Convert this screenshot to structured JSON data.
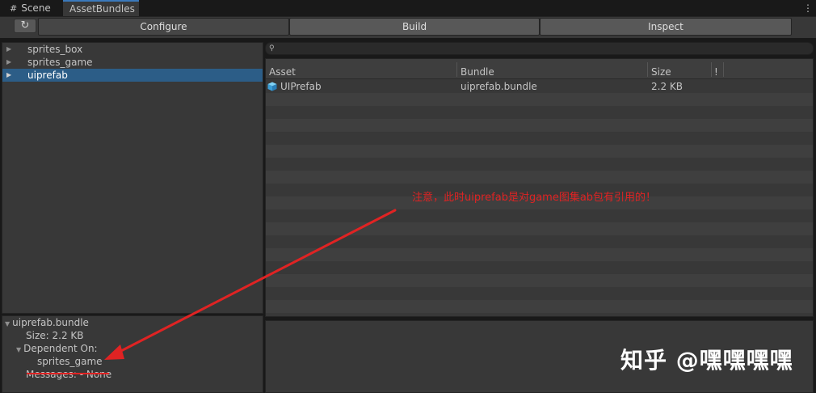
{
  "tabs": [
    {
      "icon": "grid-icon",
      "label": "Scene"
    },
    {
      "label": "AssetBundles"
    }
  ],
  "menu_glyph": "⋮",
  "toolbar": {
    "refresh_glyph": "↻",
    "modes": [
      "Configure",
      "Build",
      "Inspect"
    ],
    "selected_mode": "Configure"
  },
  "tree": {
    "items": [
      {
        "label": "sprites_box",
        "selected": false
      },
      {
        "label": "sprites_game",
        "selected": false
      },
      {
        "label": "uiprefab",
        "selected": true
      }
    ]
  },
  "details": {
    "bundle": "uiprefab.bundle",
    "size": "Size: 2.2 KB",
    "dependent_label": "Dependent On:",
    "dependency": "sprites_game",
    "messages": "Messages: - None"
  },
  "search": {
    "placeholder": ""
  },
  "table": {
    "columns": [
      "Asset",
      "Bundle",
      "Size",
      "!"
    ],
    "rows": [
      {
        "asset": "UIPrefab",
        "bundle": "uiprefab.bundle",
        "size": "2.2 KB"
      }
    ]
  },
  "annotation": {
    "text": "注意，此时uiprefab是对game图集ab包有引用的！",
    "color": "#e02323"
  },
  "watermark": "知乎 @嘿嘿嘿嘿",
  "colors": {
    "selection": "#2c5d87",
    "tab_accent": "#3a79bb",
    "icon": "#4fb3e8"
  }
}
